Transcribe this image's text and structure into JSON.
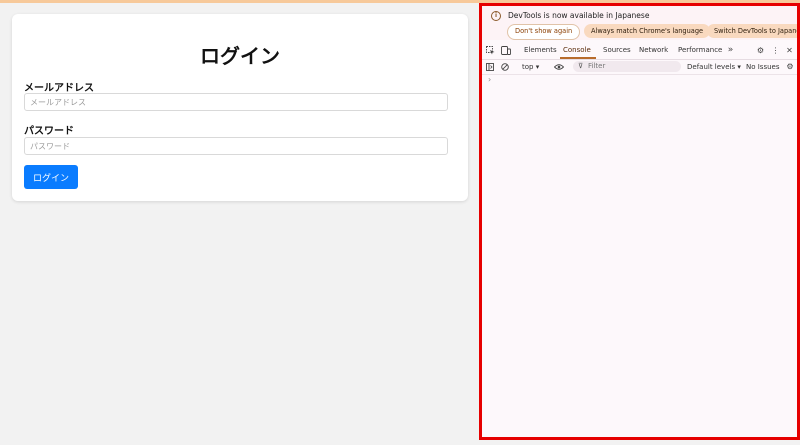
{
  "login": {
    "title": "ログイン",
    "email_label": "メールアドレス",
    "email_placeholder": "メールアドレス",
    "password_label": "パスワード",
    "password_placeholder": "パスワード",
    "submit_label": "ログイン"
  },
  "devtools": {
    "notice": {
      "message": "DevTools is now available in Japanese",
      "dont_show": "Don't show again",
      "always_match": "Always match Chrome's language",
      "switch": "Switch DevTools to Japanese"
    },
    "tabs": [
      "Elements",
      "Console",
      "Sources",
      "Network",
      "Performance"
    ],
    "active_tab": "Console",
    "toolbar": {
      "context": "top ▾",
      "filter_placeholder": "Filter",
      "levels": "Default levels ▾",
      "issues": "No Issues"
    },
    "prompt": "›"
  },
  "colors": {
    "primary_button": "#0a7cff",
    "highlight_border": "#e60000"
  }
}
